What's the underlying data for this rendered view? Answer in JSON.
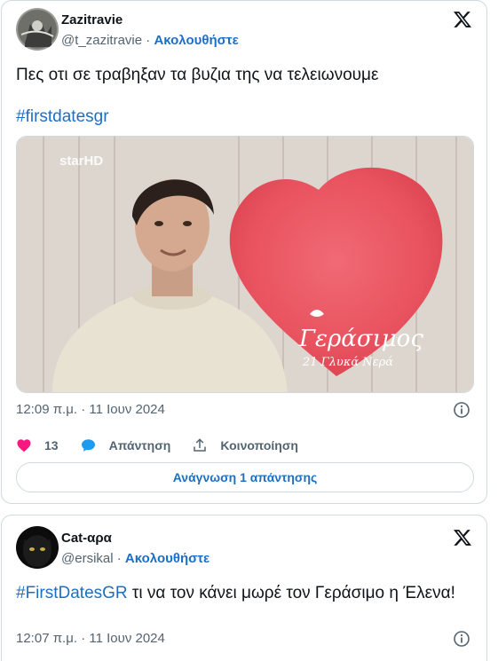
{
  "tweets": [
    {
      "user": {
        "name": "Zazitravie",
        "handle": "@t_zazitravie",
        "separator": " · ",
        "follow_label": "Ακολουθήστε"
      },
      "text": "Πες οτι σε τραβηξαν τα βυζια της να τελειωνουμε",
      "hashtag": "#firstdatesgr",
      "media": {
        "channel_logo": "starHD",
        "caption_name": "Γεράσιμος",
        "caption_sub": "21 Γλυκά Νερά"
      },
      "timestamp": "12:09 π.μ. · 11 Ιουν 2024",
      "likes": "13",
      "reply_label": "Απάντηση",
      "share_label": "Κοινοποίηση",
      "read_replies_label": "Ανάγνωση 1 απάντησης"
    },
    {
      "user": {
        "name": "Cat-αρα",
        "handle": "@ersikal",
        "separator": " · ",
        "follow_label": "Ακολουθήστε"
      },
      "hashtag": "#FirstDatesGR",
      "text": " τι να τον κάνει μωρέ τον Γεράσιμο η Έλενα!",
      "timestamp": "12:07 π.μ. · 11 Ιουν 2024"
    }
  ],
  "colors": {
    "link": "#1d6fc4",
    "like": "#f91880",
    "border": "#cfd9de",
    "muted": "#536471"
  },
  "icons": [
    "x-logo-icon",
    "info-icon",
    "heart-icon",
    "reply-bubble-icon",
    "share-icon"
  ]
}
